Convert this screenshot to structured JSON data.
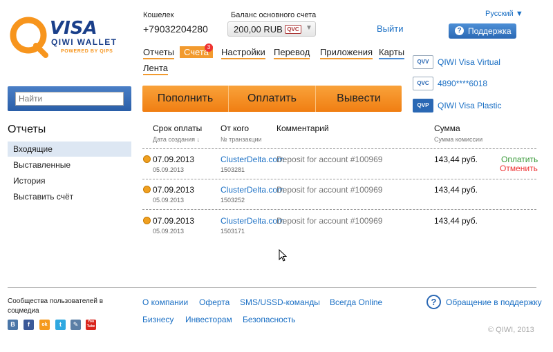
{
  "logo": {
    "brand": "VISA",
    "product": "QIWI WALLET",
    "tagline": "POWERED BY QIPS"
  },
  "header": {
    "wallet_label": "Кошелек",
    "wallet_number": "+79032204280",
    "balance_label": "Баланс основного счета",
    "balance_value": "200,00 RUB",
    "balance_wallet_tag": "QVC",
    "logout": "Выйти",
    "language": "Русский ▼",
    "support": "Поддержка"
  },
  "nav": [
    {
      "label": "Отчеты"
    },
    {
      "label": "Счета",
      "badge": "3"
    },
    {
      "label": "Настройки"
    },
    {
      "label": "Перевод"
    },
    {
      "label": "Приложения"
    },
    {
      "label": "Карты"
    },
    {
      "label": "Лента"
    }
  ],
  "cards": [
    {
      "icon": "QVV",
      "label": "QIWI Visa Virtual"
    },
    {
      "icon": "QVC",
      "label": "4890****6018"
    },
    {
      "icon": "QVP",
      "label": "QIWI Visa Plastic"
    }
  ],
  "sidebar": {
    "search_placeholder": "Найти",
    "title": "Отчеты",
    "items": [
      "Входящие",
      "Выставленные",
      "История",
      "Выставить счёт"
    ]
  },
  "actions": [
    "Пополнить",
    "Оплатить",
    "Вывести"
  ],
  "table": {
    "headers": {
      "due": "Срок оплаты",
      "due_sub": "Дата создания ↓",
      "from": "От кого",
      "from_sub": "№ транзакции",
      "comment": "Комментарий",
      "sum": "Сумма",
      "sum_sub": "Сумма комиссии"
    },
    "rows": [
      {
        "due": "07.09.2013",
        "created": "05.09.2013",
        "from": "ClusterDelta.com",
        "txn": "1503281",
        "comment": "Deposit for account #100969",
        "sum": "143,44 руб.",
        "pay": "Оплатить",
        "cancel": "Отменить"
      },
      {
        "due": "07.09.2013",
        "created": "05.09.2013",
        "from": "ClusterDelta.com",
        "txn": "1503252",
        "comment": "Deposit for account #100969",
        "sum": "143,44 руб."
      },
      {
        "due": "07.09.2013",
        "created": "05.09.2013",
        "from": "ClusterDelta.com",
        "txn": "1503171",
        "comment": "Deposit for account #100969",
        "sum": "143,44 руб."
      }
    ]
  },
  "footer": {
    "community": "Сообщества пользователей в соцмедиа",
    "social": [
      "В",
      "f",
      "ok",
      "t",
      "✎",
      "You Tube"
    ],
    "links_row1": [
      "О компании",
      "Оферта",
      "SMS/USSD-команды",
      "Всегда Online"
    ],
    "links_row2": [
      "Бизнесу",
      "Инвесторам",
      "Безопасность"
    ],
    "support_link": "Обращение в поддержку",
    "copyright": "© QIWI, 2013"
  },
  "colors": {
    "orange": "#f29a2e",
    "blue": "#2a68b4",
    "link": "#1a6fc4"
  }
}
